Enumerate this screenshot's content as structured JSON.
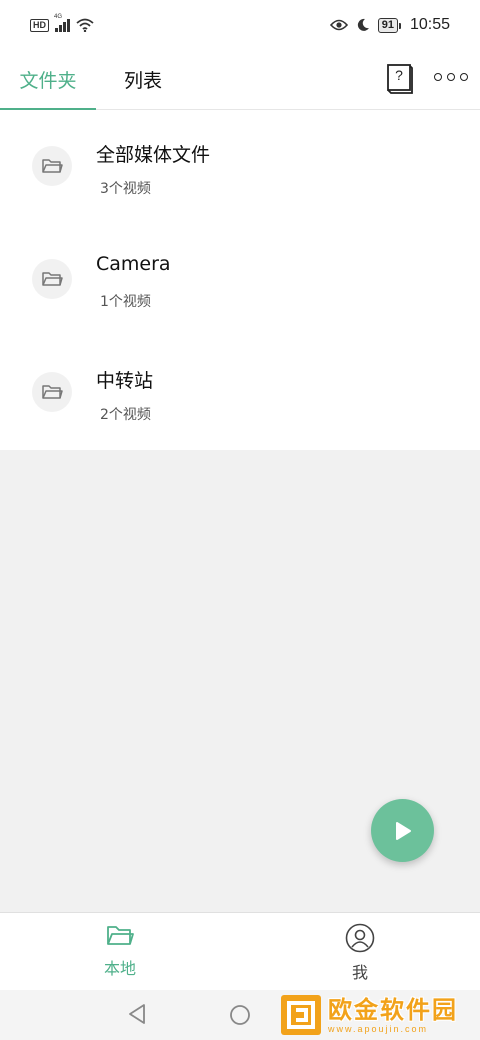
{
  "status_bar": {
    "hd_label": "HD",
    "network_label": "4G",
    "battery_level": "91",
    "time": "10:55"
  },
  "tabs": [
    {
      "label": "文件夹",
      "active": true
    },
    {
      "label": "列表",
      "active": false
    }
  ],
  "toolbar": {
    "help_icon_glyph": "?",
    "icons": [
      "help-book-icon",
      "more-icon"
    ]
  },
  "folders": [
    {
      "name": "全部媒体文件",
      "count": "3个视频",
      "icon": "folder-icon"
    },
    {
      "name": "Camera",
      "count": "1个视频",
      "icon": "folder-icon"
    },
    {
      "name": "中转站",
      "count": "2个视频",
      "icon": "folder-icon"
    }
  ],
  "fab": {
    "icon": "play-icon"
  },
  "bottom_nav": [
    {
      "label": "本地",
      "icon": "folder-open-icon",
      "active": true
    },
    {
      "label": "我",
      "icon": "user-icon",
      "active": false
    }
  ],
  "watermark": {
    "title": "欧金软件园",
    "url": "www.apoujin.com"
  },
  "colors": {
    "accent": "#4fb08a",
    "fab": "#6cc19b",
    "background": "#f1f1f1",
    "watermark": "#f2a21a"
  }
}
